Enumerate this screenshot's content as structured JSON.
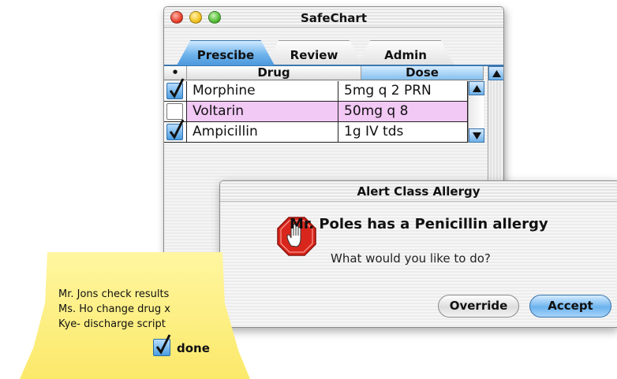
{
  "window": {
    "title": "SafeChart"
  },
  "tabs": [
    {
      "label": "Prescibe",
      "active": true
    },
    {
      "label": "Review",
      "active": false
    },
    {
      "label": "Admin",
      "active": false
    }
  ],
  "table": {
    "headers": {
      "check": "•",
      "drug": "Drug",
      "dose": "Dose"
    },
    "rows": [
      {
        "checked": true,
        "drug": "Morphine",
        "dose": "5mg q 2 PRN",
        "highlighted": false
      },
      {
        "checked": false,
        "drug": "Voltarin",
        "dose": "50mg q 8",
        "highlighted": true
      },
      {
        "checked": true,
        "drug": "Ampicillin",
        "dose": "1g IV tds",
        "highlighted": false
      }
    ]
  },
  "alert": {
    "title": "Alert Class Allergy",
    "message": "Mr. Poles has a Penicillin allergy",
    "question": "What would you like to do?",
    "override_label": "Override",
    "accept_label": "Accept",
    "icon": "stop-hand-icon"
  },
  "note": {
    "lines": [
      "Mr. Jons check results",
      "Ms. Ho change drug x",
      "Kye- discharge script"
    ],
    "done_label": "done",
    "done_checked": true
  },
  "colors": {
    "accent": "#4b98dc",
    "highlight_row": "#f2c8f5",
    "note": "#fbe96a",
    "stop_icon": "#d9261c"
  }
}
